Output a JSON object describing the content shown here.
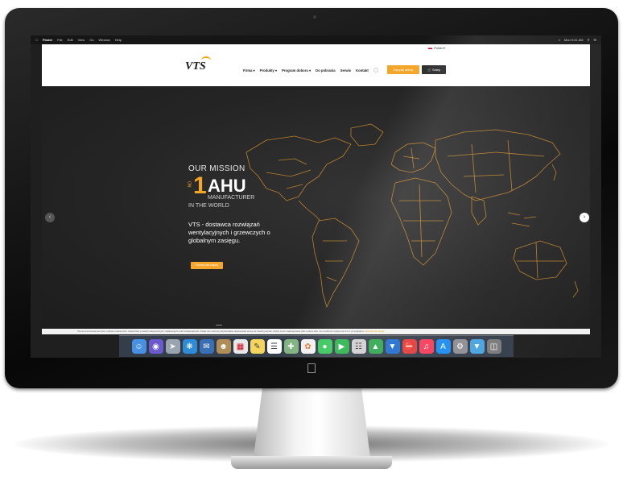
{
  "menubar": {
    "app": "Finder",
    "items": [
      "File",
      "Edit",
      "View",
      "Go",
      "Window",
      "Help"
    ],
    "clock": "Mon 9:41 AM"
  },
  "site": {
    "language": "Polski",
    "logo_text": "VTS",
    "nav": [
      "Firma",
      "Produkty",
      "Program doboru",
      "Do pobrania",
      "Serwis",
      "Kontakt"
    ],
    "quote_button": "Zapytaj ofertę",
    "sklep_button": "Sklep"
  },
  "hero": {
    "mission": "OUR MISSION",
    "number": "1",
    "no": "NO.",
    "ahu": "AHU",
    "manufacturer": "MANUFACTURER",
    "world": "IN THE WORLD",
    "tagline": "VTS - dostawca rozwiązań wentylacyjnych i grzewczych o globalnym zasięgu.",
    "button": "Poznaj nas więcej"
  },
  "cookie": {
    "text": "Strona internetowa korzysta z plików cookies (tzw. ciasteczek) w celach statystycznych, reklamowych oraz funkcjonalnych. Dzięki nim możemy indywidualnie dostosować stronę do Twoich potrzeb. Każdy może zaakceptować pliki cookies albo ma możliwość wyłączenia ich w przeglądarce.",
    "accent": "Dowiedz się więcej"
  },
  "colors": {
    "accent": "#f4a62a",
    "dark": "#2b2b2b"
  }
}
